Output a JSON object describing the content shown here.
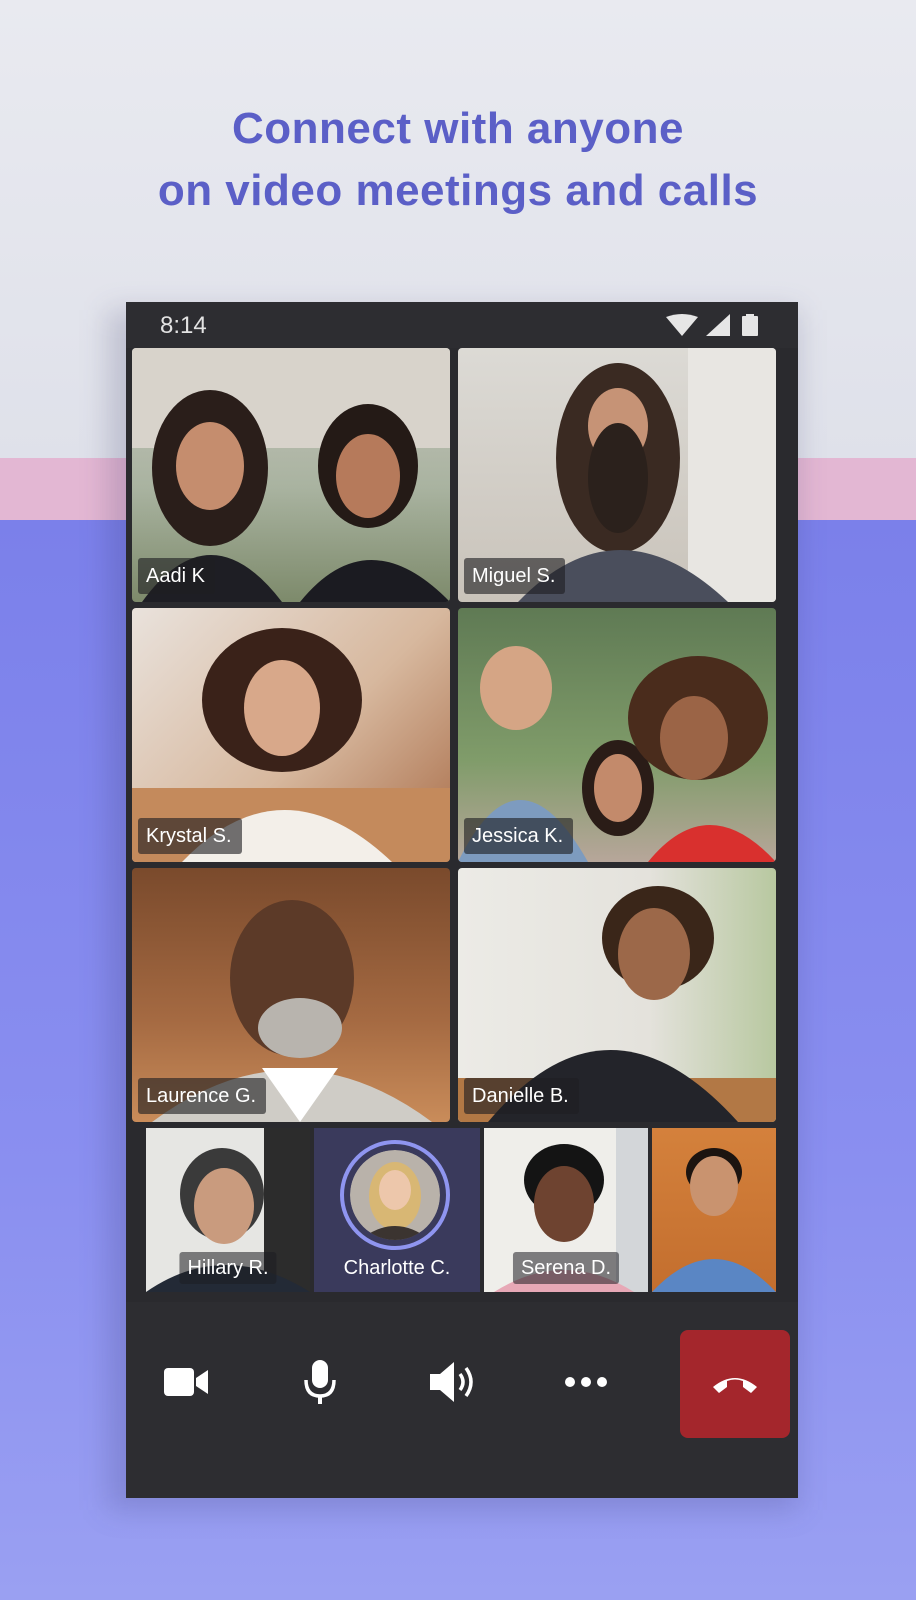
{
  "headline": {
    "line1": "Connect with anyone",
    "line2": "on video meetings and calls"
  },
  "status_bar": {
    "time": "8:14",
    "icons": [
      "wifi-icon",
      "cellular-signal-icon",
      "battery-icon"
    ]
  },
  "participants_grid": [
    {
      "name": "Aadi K"
    },
    {
      "name": "Miguel S."
    },
    {
      "name": "Krystal S."
    },
    {
      "name": "Jessica K."
    },
    {
      "name": "Laurence G."
    },
    {
      "name": "Danielle B."
    }
  ],
  "participants_strip": [
    {
      "name": "Hillary R."
    },
    {
      "name": "Charlotte C.",
      "speaking": true
    },
    {
      "name": "Serena D."
    },
    {
      "name": ""
    }
  ],
  "call_controls": {
    "buttons": [
      "video-camera-icon",
      "microphone-icon",
      "speaker-icon",
      "more-options-icon",
      "hang-up-icon"
    ]
  },
  "colors": {
    "headline": "#5b5fc7",
    "hangup": "#a4262c",
    "speaking_ring": "#8f95f0",
    "background_blue": "#7b80ea",
    "background_pink": "#e3b7d3"
  }
}
